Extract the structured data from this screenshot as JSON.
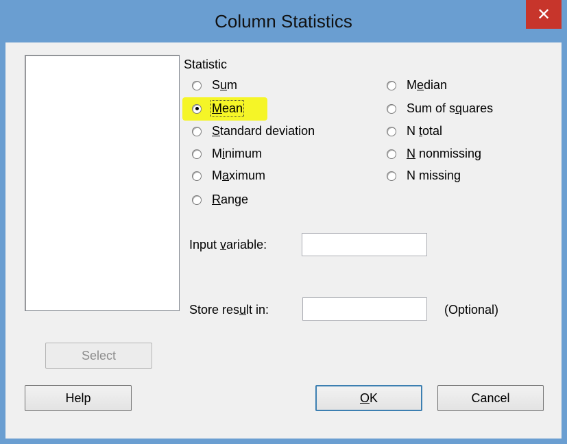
{
  "window": {
    "title": "Column Statistics",
    "close_glyph": "✕"
  },
  "statistic": {
    "group_label": "Statistic",
    "selected": "Mean",
    "left_options": [
      {
        "pre": "S",
        "u": "u",
        "post": "m"
      },
      {
        "pre": "",
        "u": "M",
        "post": "ean"
      },
      {
        "pre": "",
        "u": "S",
        "post": "tandard deviation"
      },
      {
        "pre": "M",
        "u": "i",
        "post": "nimum"
      },
      {
        "pre": "M",
        "u": "a",
        "post": "ximum"
      },
      {
        "pre": "",
        "u": "R",
        "post": "ange"
      }
    ],
    "right_options": [
      {
        "pre": "M",
        "u": "e",
        "post": "dian"
      },
      {
        "pre": "Sum of s",
        "u": "q",
        "post": "uares"
      },
      {
        "pre": "N ",
        "u": "t",
        "post": "otal"
      },
      {
        "pre": "",
        "u": "N",
        "post": " nonmissing"
      },
      {
        "pre": "N missin",
        "u": "g",
        "post": ""
      }
    ]
  },
  "input_variable": {
    "pre": "Input ",
    "u": "v",
    "post": "ariable:",
    "value": ""
  },
  "store_result": {
    "pre": "Store res",
    "u": "u",
    "post": "lt in:",
    "value": "",
    "hint": "(Optional)"
  },
  "buttons": {
    "select": "Select",
    "help": "Help",
    "ok": {
      "pre": "",
      "u": "O",
      "post": "K"
    },
    "cancel": "Cancel"
  },
  "colors": {
    "title_bar": "#6a9ed1",
    "close_button": "#c7352b",
    "highlight": "#f5f527"
  }
}
